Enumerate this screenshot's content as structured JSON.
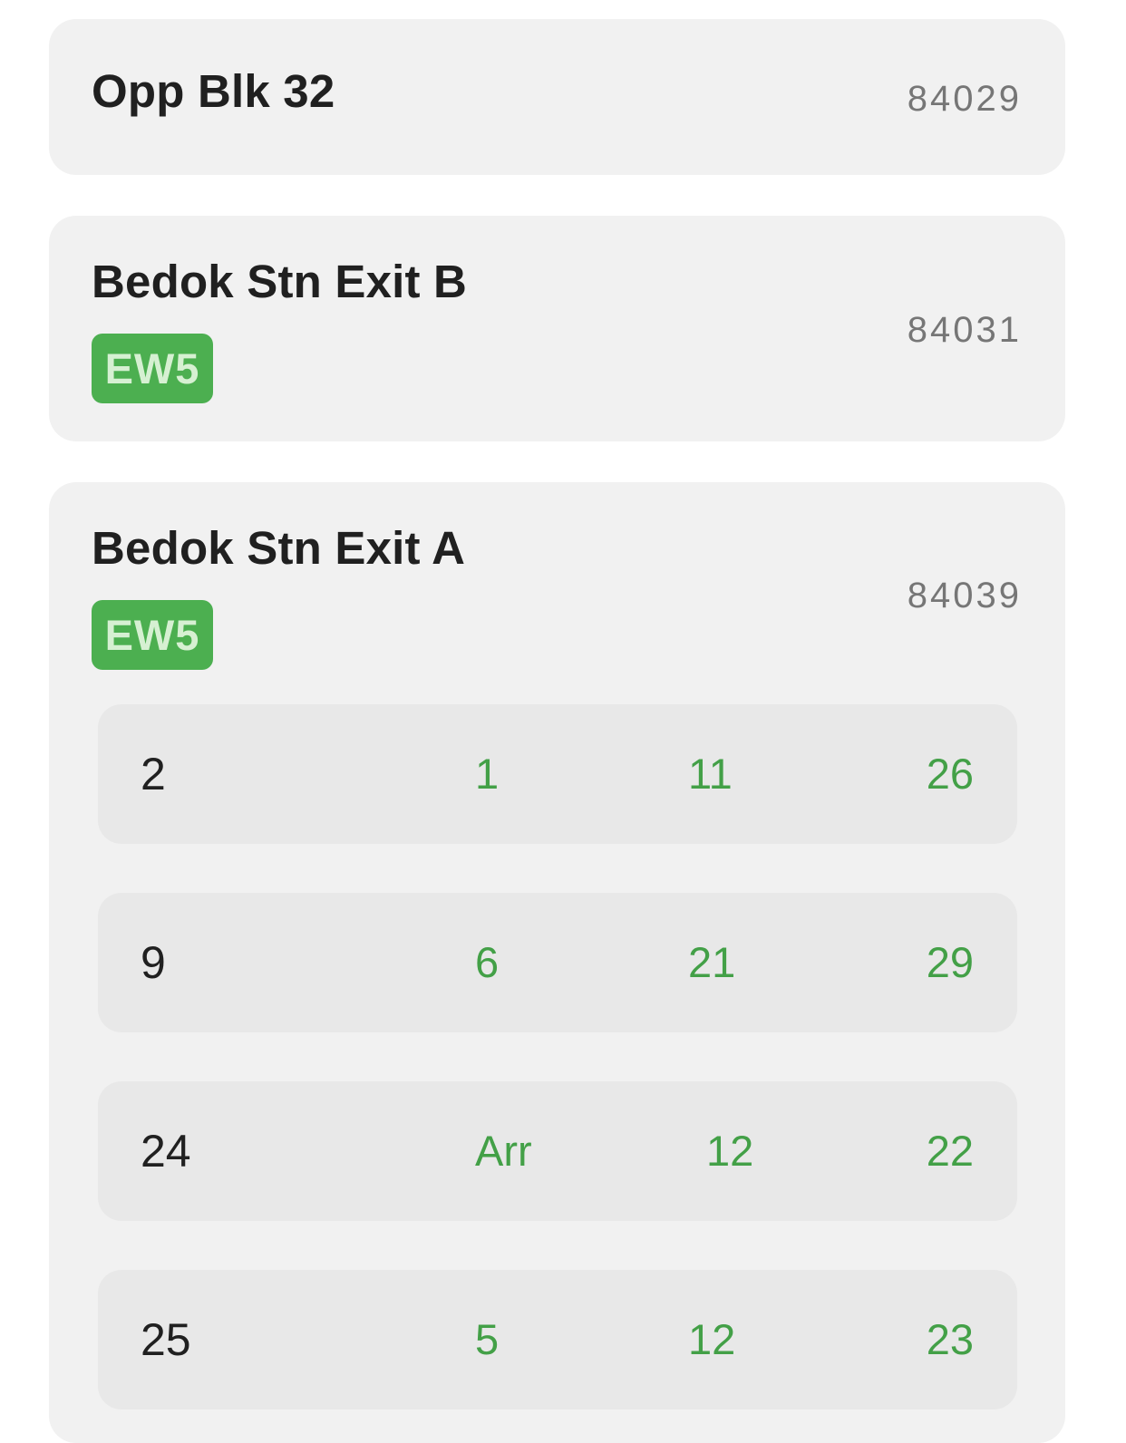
{
  "stops": [
    {
      "name": "Opp Blk 32",
      "code": "84029"
    },
    {
      "name": "Bedok Stn Exit B",
      "code": "84031",
      "badge": "EW5"
    },
    {
      "name": "Bedok Stn Exit A",
      "code": "84039",
      "badge": "EW5",
      "services": [
        {
          "number": "2",
          "arrivals": [
            "1",
            "11",
            "26"
          ]
        },
        {
          "number": "9",
          "arrivals": [
            "6",
            "21",
            "29"
          ]
        },
        {
          "number": "24",
          "arrivals": [
            "Arr",
            "12",
            "22"
          ]
        },
        {
          "number": "25",
          "arrivals": [
            "5",
            "12",
            "23"
          ]
        }
      ]
    }
  ],
  "colors": {
    "card_bg": "#f1f1f1",
    "row_bg": "#e8e8e8",
    "badge_bg": "#4caf50",
    "badge_text": "#d6f0d2",
    "eta_text": "#43a047",
    "title_text": "#202020",
    "code_text": "#767676"
  }
}
